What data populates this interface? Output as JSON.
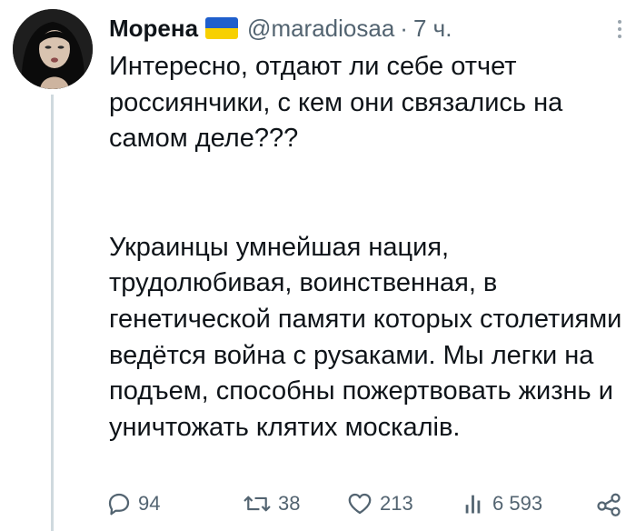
{
  "author": {
    "name": "Морена",
    "handle": "@maradiosaa",
    "separator": "·",
    "time": "7 ч.",
    "flag_colors": [
      "#1f5fcc",
      "#f7d000"
    ]
  },
  "tweet": {
    "paragraph1": "Интересно, отдают ли себе отчет россиянчики, с кем они связались на самом деле???",
    "paragraph2": "Украинцы умнейшая нация, трудолюбивая, воинственная, в генетической памяти которых столетиями ведётся война с руsаками. Мы легки на подъем, способны пожертвовать жизнь и уничтожать клятих москалів."
  },
  "actions": {
    "replies": "94",
    "retweets": "38",
    "likes": "213",
    "views": "6 593",
    "icons": [
      "reply-icon",
      "retweet-icon",
      "like-icon",
      "views-icon",
      "share-icon"
    ]
  }
}
